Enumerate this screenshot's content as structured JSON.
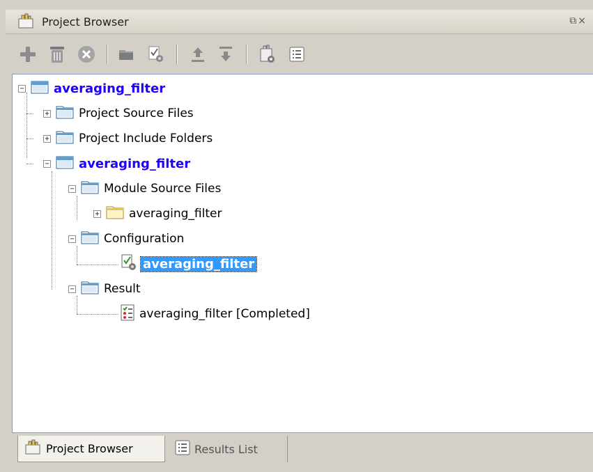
{
  "window": {
    "title": "Project Browser",
    "window_controls": "⧉×"
  },
  "toolbar": {
    "buttons": [
      {
        "name": "add-icon"
      },
      {
        "name": "trash-icon"
      },
      {
        "name": "stop-icon"
      },
      {
        "name": "folder-icon"
      },
      {
        "name": "configuration-icon"
      },
      {
        "name": "upload-icon"
      },
      {
        "name": "download-icon"
      },
      {
        "name": "properties-icon"
      },
      {
        "name": "list-icon"
      }
    ]
  },
  "tree": {
    "root": {
      "label": "averaging_filter",
      "expanded": true
    },
    "source_files": {
      "label": "Project Source Files",
      "expanded": false
    },
    "include_folders": {
      "label": "Project Include Folders",
      "expanded": false
    },
    "module": {
      "label": "averaging_filter",
      "expanded": true
    },
    "module_source": {
      "label": "Module Source Files",
      "expanded": true
    },
    "module_source_item": {
      "label": "averaging_filter",
      "expanded": false
    },
    "configuration": {
      "label": "Configuration",
      "expanded": true
    },
    "configuration_item": {
      "label": "averaging_filter",
      "selected": true
    },
    "result": {
      "label": "Result",
      "expanded": true
    },
    "result_item": {
      "label": "averaging_filter [Completed]"
    }
  },
  "tabs": {
    "project_browser": "Project Browser",
    "results_list": "Results List"
  },
  "colors": {
    "accent": "#1e00ff",
    "selection": "#3399ff",
    "folder": "#5aa0d8",
    "folder_yellow": "#e8c44a"
  }
}
